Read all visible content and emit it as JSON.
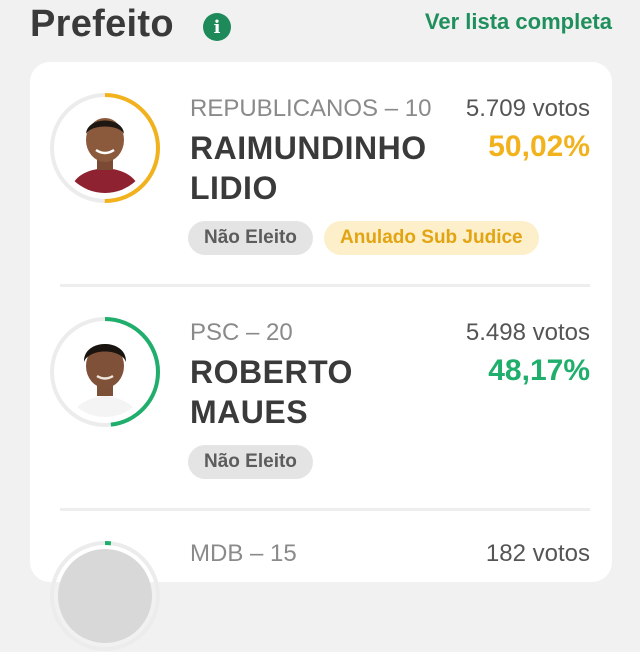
{
  "header": {
    "title": "Prefeito",
    "info_icon": "info-icon",
    "list_link": "Ver lista completa"
  },
  "colors": {
    "brand_green": "#1f8f5c",
    "elected_yellow": "#f2b21e",
    "percent_green": "#1fae6b"
  },
  "candidates": [
    {
      "party": "REPUBLICANOS – 10",
      "name_line1": "RAIMUNDINHO",
      "name_line2": "LIDIO",
      "votes": "5.709 votos",
      "percent": "50,02%",
      "percent_value": 50.02,
      "status": "Não Eleito",
      "note": "Anulado Sub Judice"
    },
    {
      "party": "PSC – 20",
      "name_line1": "ROBERTO",
      "name_line2": "MAUES",
      "votes": "5.498 votos",
      "percent": "48,17%",
      "percent_value": 48.17,
      "status": "Não Eleito"
    },
    {
      "party": "MDB – 15",
      "votes": "182 votos"
    }
  ]
}
